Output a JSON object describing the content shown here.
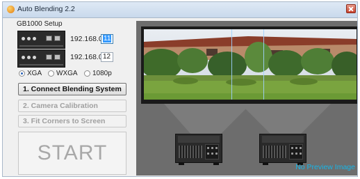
{
  "window": {
    "title": "Auto Blending 2.2"
  },
  "setup": {
    "label": "GB1000 Setup",
    "ip_prefix_1": "192.168.0.",
    "ip_value_1": "11",
    "ip_prefix_2": "192.168.0.",
    "ip_value_2": "12"
  },
  "resolution": {
    "options": [
      "XGA",
      "WXGA",
      "1080p"
    ],
    "selected": "XGA"
  },
  "steps": {
    "connect": "1. Connect Blending System",
    "calibrate": "2. Camera Calibration",
    "fit": "3. Fit Corners to Screen",
    "start": "START"
  },
  "preview": {
    "status": "No Preview Image"
  },
  "colors": {
    "accent": "#3399ff",
    "status_text": "#17b6e8",
    "preview_bg": "#6d6d6d"
  }
}
